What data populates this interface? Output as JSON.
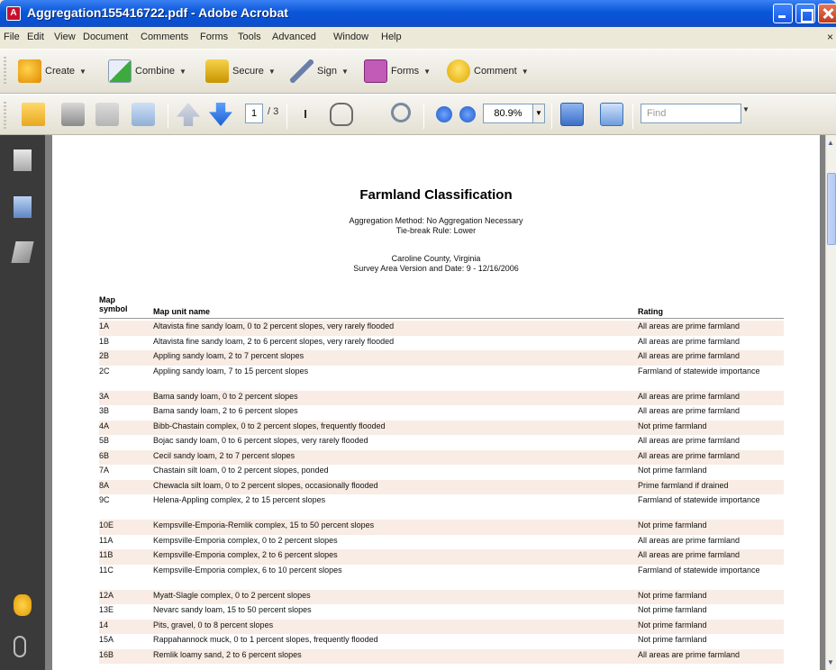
{
  "window": {
    "title": "Aggregation155416722.pdf - Adobe Acrobat"
  },
  "menu": [
    "File",
    "Edit",
    "View",
    "Document",
    "Comments",
    "Forms",
    "Tools",
    "Advanced",
    "Window",
    "Help"
  ],
  "toolbar1": {
    "create": "Create",
    "combine": "Combine",
    "secure": "Secure",
    "sign": "Sign",
    "forms": "Forms",
    "comment": "Comment"
  },
  "toolbar2": {
    "page_current": "1",
    "page_total": "/ 3",
    "zoom": "80.9%",
    "find_placeholder": "Find"
  },
  "document": {
    "title": "Farmland Classification",
    "aggregation": "Aggregation Method: No Aggregation Necessary",
    "tiebreak": "Tie-break Rule: Lower",
    "county": "Caroline County, Virginia",
    "survey": "Survey Area Version and Date: 9 - 12/16/2006",
    "headers": {
      "symbol": "Map symbol",
      "name": "Map unit name",
      "rating": "Rating"
    },
    "rows": [
      {
        "symbol": "1A",
        "name": "Altavista fine sandy loam, 0 to 2 percent slopes, very rarely flooded",
        "rating": "All areas are prime farmland"
      },
      {
        "symbol": "1B",
        "name": "Altavista fine sandy loam, 2 to 6 percent slopes, very rarely flooded",
        "rating": "All areas are prime farmland"
      },
      {
        "symbol": "2B",
        "name": "Appling sandy loam, 2 to 7 percent slopes",
        "rating": "All areas are prime farmland"
      },
      {
        "symbol": "2C",
        "name": "Appling sandy loam, 7 to 15 percent slopes",
        "rating": "Farmland of statewide importance"
      },
      {
        "symbol": "3A",
        "name": "Bama sandy loam, 0 to 2 percent slopes",
        "rating": "All areas are prime farmland"
      },
      {
        "symbol": "3B",
        "name": "Bama sandy loam, 2 to 6 percent slopes",
        "rating": "All areas are prime farmland"
      },
      {
        "symbol": "4A",
        "name": "Bibb-Chastain complex, 0 to 2 percent slopes, frequently flooded",
        "rating": "Not prime farmland"
      },
      {
        "symbol": "5B",
        "name": "Bojac sandy loam, 0 to 6 percent slopes, very rarely flooded",
        "rating": "All areas are prime farmland"
      },
      {
        "symbol": "6B",
        "name": "Cecil sandy loam, 2 to 7 percent slopes",
        "rating": "All areas are prime farmland"
      },
      {
        "symbol": "7A",
        "name": "Chastain silt loam, 0 to 2 percent slopes, ponded",
        "rating": "Not prime farmland"
      },
      {
        "symbol": "8A",
        "name": "Chewacla silt loam, 0 to 2 percent slopes, occasionally flooded",
        "rating": "Prime farmland if drained"
      },
      {
        "symbol": "9C",
        "name": "Helena-Appling complex, 2 to 15 percent slopes",
        "rating": "Farmland of statewide importance"
      },
      {
        "symbol": "10E",
        "name": "Kempsville-Emporia-Remlik complex, 15 to 50 percent slopes",
        "rating": "Not prime farmland"
      },
      {
        "symbol": "11A",
        "name": "Kempsville-Emporia complex, 0 to 2 percent slopes",
        "rating": "All areas are prime farmland"
      },
      {
        "symbol": "11B",
        "name": "Kempsville-Emporia complex, 2 to 6 percent slopes",
        "rating": "All areas are prime farmland"
      },
      {
        "symbol": "11C",
        "name": "Kempsville-Emporia complex, 6 to 10 percent slopes",
        "rating": "Farmland of statewide importance"
      },
      {
        "symbol": "12A",
        "name": "Myatt-Slagle complex, 0 to 2 percent slopes",
        "rating": "Not prime farmland"
      },
      {
        "symbol": "13E",
        "name": "Nevarc sandy loam, 15 to 50 percent slopes",
        "rating": "Not prime farmland"
      },
      {
        "symbol": "14",
        "name": "Pits, gravel, 0 to 8 percent slopes",
        "rating": "Not prime farmland"
      },
      {
        "symbol": "15A",
        "name": "Rappahannock muck, 0 to 1 percent slopes, frequently flooded",
        "rating": "Not prime farmland"
      },
      {
        "symbol": "16B",
        "name": "Remlik loamy sand, 2 to 6 percent slopes",
        "rating": "All areas are prime farmland"
      }
    ]
  },
  "colors": {
    "titlebar": "#0b4fd0",
    "nav_pane": "#3a3a3a",
    "row_alt": "#f8ece4"
  }
}
